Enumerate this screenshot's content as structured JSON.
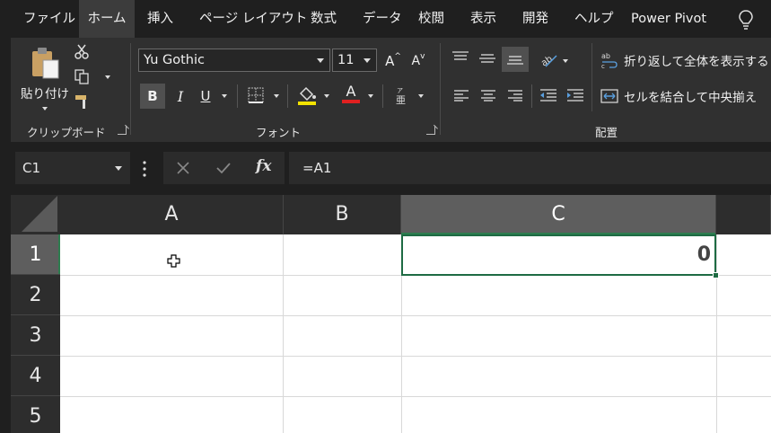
{
  "tabs": [
    "ファイル",
    "ホーム",
    "挿入",
    "ページ レイアウト",
    "数式",
    "データ",
    "校閲",
    "表示",
    "開発",
    "ヘルプ",
    "Power Pivot"
  ],
  "active_tab": "ホーム",
  "ribbon": {
    "clipboard": {
      "paste_label": "貼り付け",
      "group_label": "クリップボード"
    },
    "font": {
      "font_name": "Yu Gothic",
      "font_size": "11",
      "group_label": "フォント",
      "bold": "B",
      "italic": "I",
      "underline": "U",
      "font_color_letter": "A",
      "grow_font": "A",
      "shrink_font": "A"
    },
    "alignment": {
      "wrap_text": "折り返して全体を表示する",
      "merge_center": "セルを結合して中央揃え",
      "group_label": "配置"
    }
  },
  "formula_bar": {
    "name_box": "C1",
    "formula": "=A1",
    "fx": "fx"
  },
  "columns": [
    "A",
    "B",
    "C"
  ],
  "rows": [
    "1",
    "2",
    "3",
    "4",
    "5"
  ],
  "selected_cell": "C1",
  "cells": {
    "C1": "0"
  },
  "colors": {
    "selection": "#1e6b43",
    "ribbon": "#303030",
    "header_selected": "#5e5e5e"
  }
}
